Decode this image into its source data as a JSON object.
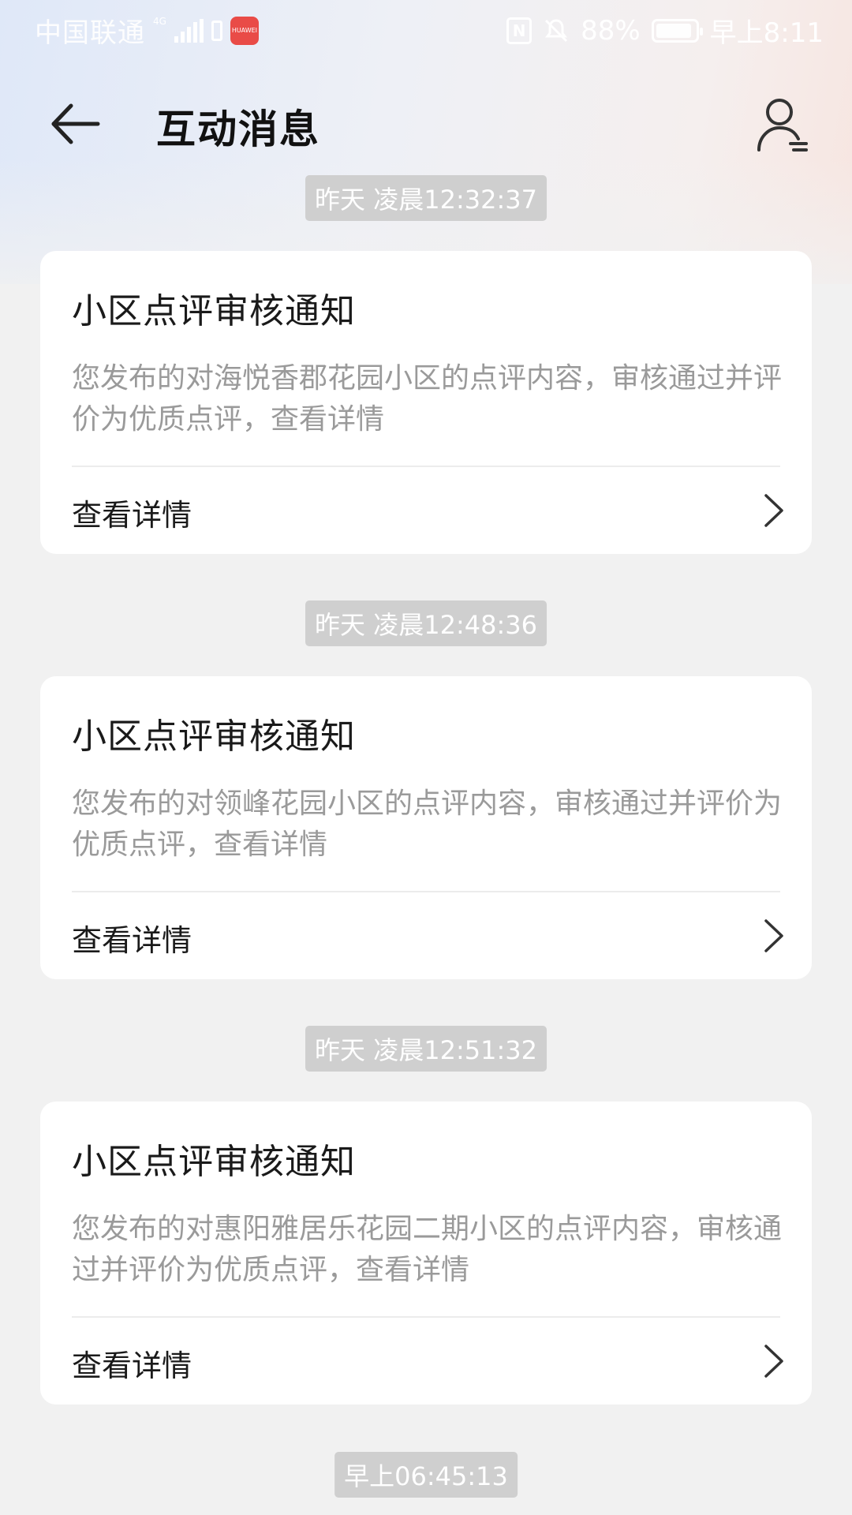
{
  "status_bar": {
    "carrier": "中国联通",
    "network": "4G",
    "app_badge_text": "HUAWEI",
    "battery": "88%",
    "time": "早上8:11"
  },
  "header": {
    "title": "互动消息"
  },
  "messages": [
    {
      "timestamp": "昨天 凌晨12:32:37",
      "title": "小区点评审核通知",
      "body": "您发布的对海悦香郡花园小区的点评内容，审核通过并评价为优质点评，查看详情",
      "action": "查看详情"
    },
    {
      "timestamp": "昨天 凌晨12:48:36",
      "title": "小区点评审核通知",
      "body": "您发布的对领峰花园小区的点评内容，审核通过并评价为优质点评，查看详情",
      "action": "查看详情"
    },
    {
      "timestamp": "昨天 凌晨12:51:32",
      "title": "小区点评审核通知",
      "body": "您发布的对惠阳雅居乐花园二期小区的点评内容，审核通过并评价为优质点评，查看详情",
      "action": "查看详情"
    }
  ],
  "last_timestamp": "早上06:45:13",
  "icons": {
    "back": "arrow-left-icon",
    "profile": "user-settings-icon",
    "chevron": "chevron-right-icon"
  }
}
